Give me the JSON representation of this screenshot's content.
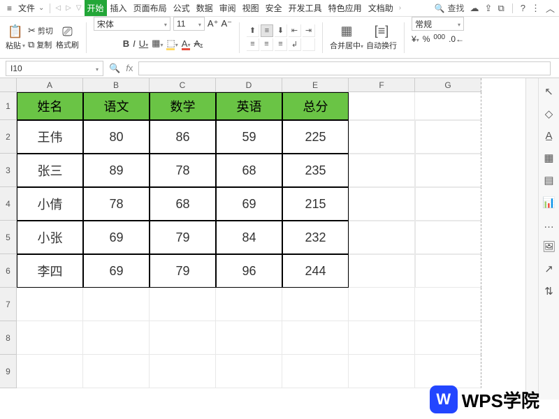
{
  "menubar": {
    "file_menu": "文件",
    "tabs": [
      "开始",
      "插入",
      "页面布局",
      "公式",
      "数据",
      "审阅",
      "视图",
      "安全",
      "开发工具",
      "特色应用",
      "文档助"
    ],
    "search_label": "查找"
  },
  "ribbon": {
    "paste_label": "粘贴",
    "cut_label": "剪切",
    "copy_label": "复制",
    "format_brush_label": "格式刷",
    "font_name": "宋体",
    "font_size": "11",
    "merge_center_label": "合并居中",
    "auto_wrap_label": "自动换行",
    "number_format": "常规"
  },
  "namebox": {
    "cell_ref": "I10"
  },
  "sheet": {
    "columns": [
      "A",
      "B",
      "C",
      "D",
      "E",
      "F",
      "G"
    ],
    "header_row": [
      "姓名",
      "语文",
      "数学",
      "英语",
      "总分"
    ],
    "data_rows": [
      {
        "name": "王伟",
        "c1": "80",
        "c2": "86",
        "c3": "59",
        "c4": "225"
      },
      {
        "name": "张三",
        "c1": "89",
        "c2": "78",
        "c3": "68",
        "c4": "235"
      },
      {
        "name": "小倩",
        "c1": "78",
        "c2": "68",
        "c3": "69",
        "c4": "215"
      },
      {
        "name": "小张",
        "c1": "69",
        "c2": "79",
        "c3": "84",
        "c4": "232"
      },
      {
        "name": "李四",
        "c1": "69",
        "c2": "79",
        "c3": "96",
        "c4": "244"
      }
    ],
    "row_numbers": [
      "1",
      "2",
      "3",
      "4",
      "5",
      "6",
      "7",
      "8",
      "9"
    ]
  },
  "watermark": {
    "logo_text": "W",
    "text": "WPS学院"
  }
}
